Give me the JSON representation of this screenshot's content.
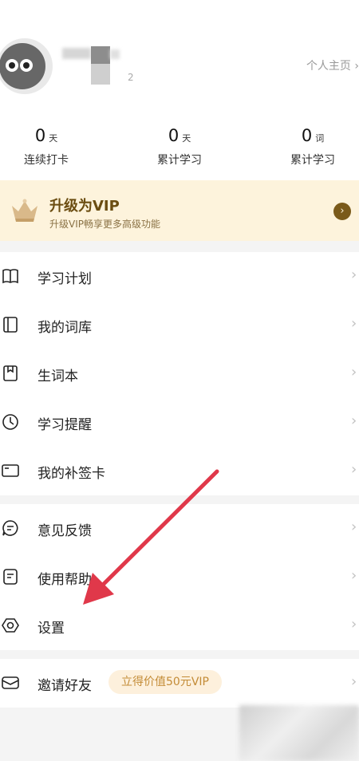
{
  "header": {
    "uid_tail": "2",
    "home_link": "个人主页 ›"
  },
  "stats": [
    {
      "num": "0",
      "unit": "天",
      "label": "连续打卡"
    },
    {
      "num": "0",
      "unit": "天",
      "label": "累计学习"
    },
    {
      "num": "0",
      "unit": "词",
      "label": "累计学习"
    }
  ],
  "vip": {
    "title": "升级为VIP",
    "subtitle": "升级VIP畅享更多高级功能",
    "go": "›",
    "accent": "#7a5a1a",
    "background": "#fdf3dc"
  },
  "menu_group1": [
    {
      "label": "学习计划",
      "icon": "book-icon"
    },
    {
      "label": "我的词库",
      "icon": "library-icon"
    },
    {
      "label": "生词本",
      "icon": "bookmark-icon"
    },
    {
      "label": "学习提醒",
      "icon": "clock-icon"
    },
    {
      "label": "我的补签卡",
      "icon": "card-icon"
    }
  ],
  "menu_group2": [
    {
      "label": "意见反馈",
      "icon": "chat-icon"
    },
    {
      "label": "使用帮助",
      "icon": "help-doc-icon"
    },
    {
      "label": "设置",
      "icon": "gear-icon"
    }
  ],
  "invite": {
    "label": "邀请好友",
    "badge": "立得价值50元VIP",
    "icon": "envelope-icon"
  },
  "chevron": "›",
  "annotation_color": "#e0384a"
}
